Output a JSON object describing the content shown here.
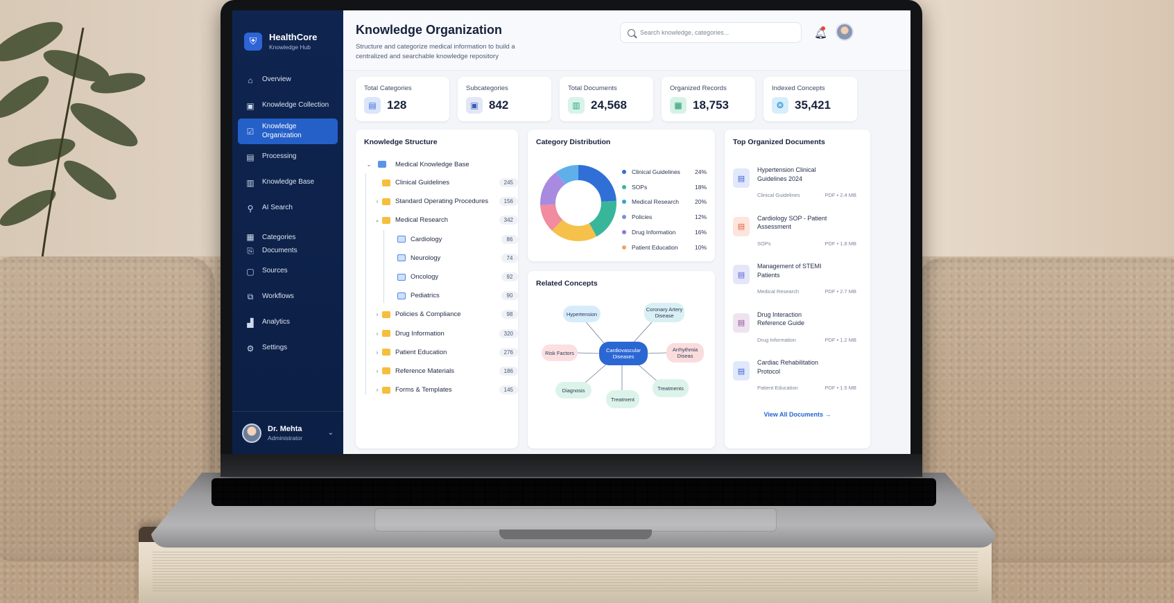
{
  "brand": {
    "title": "HealthCore",
    "subtitle": "Knowledge Hub"
  },
  "nav": [
    {
      "label": "Overview",
      "icon": "home-icon"
    },
    {
      "label": "Knowledge Collection",
      "icon": "clipboard-icon"
    },
    {
      "label": "Knowledge Organization",
      "icon": "checklist-icon",
      "active": true
    },
    {
      "label": "Processing",
      "icon": "processing-icon"
    },
    {
      "label": "Knowledge Base",
      "icon": "book-icon"
    },
    {
      "label": "AI Search",
      "icon": "search-icon"
    },
    {
      "label": "Categories",
      "icon": "categories-icon"
    },
    {
      "label": "Documents",
      "icon": "documents-icon"
    },
    {
      "label": "Sources",
      "icon": "sources-icon"
    },
    {
      "label": "Workflows",
      "icon": "workflow-icon"
    },
    {
      "label": "Analytics",
      "icon": "analytics-icon"
    },
    {
      "label": "Settings",
      "icon": "gear-icon"
    }
  ],
  "user": {
    "name": "Dr. Mehta",
    "role": "Administrator"
  },
  "header": {
    "title": "Knowledge Organization",
    "description": "Structure and categorize medical information to build a centralized and searchable knowledge repository",
    "search_placeholder": "Search knowledge, categories..."
  },
  "stats": [
    {
      "label": "Total Categories",
      "value": "128",
      "color": "#dbe6fb",
      "icon_color": "#3a6fd8"
    },
    {
      "label": "Subcategories",
      "value": "842",
      "color": "#e1e7f7",
      "icon_color": "#3b5db5"
    },
    {
      "label": "Total Documents",
      "value": "24,568",
      "color": "#d9f3ea",
      "icon_color": "#2aa57c"
    },
    {
      "label": "Organized Records",
      "value": "18,753",
      "color": "#d6f2e6",
      "icon_color": "#1f9a6c"
    },
    {
      "label": "Indexed Concepts",
      "value": "35,421",
      "color": "#d6eefb",
      "icon_color": "#2b8fd6"
    }
  ],
  "structure": {
    "title": "Knowledge Structure",
    "root": "Medical Knowledge Base",
    "items": [
      {
        "label": "Clinical Guidelines",
        "count": "245",
        "level": 1,
        "toggle": ""
      },
      {
        "label": "Standard Operating Procedures",
        "count": "156",
        "level": 1,
        "toggle": "›"
      },
      {
        "label": "Medical Research",
        "count": "342",
        "level": 1,
        "toggle": "⌄"
      },
      {
        "label": "Cardiology",
        "count": "86",
        "level": 2,
        "toggle": ""
      },
      {
        "label": "Neurology",
        "count": "74",
        "level": 2,
        "toggle": ""
      },
      {
        "label": "Oncology",
        "count": "92",
        "level": 2,
        "toggle": ""
      },
      {
        "label": "Pediatrics",
        "count": "90",
        "level": 2,
        "toggle": ""
      },
      {
        "label": "Policies & Compliance",
        "count": "98",
        "level": 1,
        "toggle": "›"
      },
      {
        "label": "Drug Information",
        "count": "320",
        "level": 1,
        "toggle": "›"
      },
      {
        "label": "Patient Education",
        "count": "276",
        "level": 1,
        "toggle": "›"
      },
      {
        "label": "Reference Materials",
        "count": "186",
        "level": 1,
        "toggle": "›"
      },
      {
        "label": "Forms & Templates",
        "count": "145",
        "level": 1,
        "toggle": "›"
      }
    ]
  },
  "distribution": {
    "title": "Category Distribution",
    "segments": [
      {
        "label": "Clinical Guidelines",
        "value": "24%",
        "pct": 24,
        "color": "#2f6fd6"
      },
      {
        "label": "SOPs",
        "value": "18%",
        "pct": 18,
        "color": "#37b69a"
      },
      {
        "label": "Medical Research",
        "value": "20%",
        "pct": 20,
        "color": "#f6c14b"
      },
      {
        "label": "Policies",
        "value": "12%",
        "pct": 12,
        "color": "#f08ba0"
      },
      {
        "label": "Drug Information",
        "value": "16%",
        "pct": 16,
        "color": "#a88be0"
      },
      {
        "label": "Patient Education",
        "value": "10%",
        "pct": 10,
        "color": "#5fb0ea"
      }
    ],
    "legend_colors": [
      "#2f6fd6",
      "#37b69a",
      "#2fa6c9",
      "#7a8fd0",
      "#8b78d8",
      "#f1a46a"
    ]
  },
  "concepts": {
    "title": "Related Concepts",
    "center": "Cardiovascular Diseases",
    "nodes": [
      "Hypertension",
      "Coronary Artery Disease",
      "Arrhythmia Diseas",
      "Risk Factors",
      "Diagnosis",
      "Treatment",
      "Treatments"
    ]
  },
  "documents": {
    "title": "Top Organized Documents",
    "items": [
      {
        "title": "Hypertension Clinical Guidelines 2024",
        "category": "Clinical Guidelines",
        "meta": "PDF • 2.4 MB",
        "bg": "#e2e8fb",
        "fg": "#3a5fcf"
      },
      {
        "title": "Cardiology SOP - Patient Assessment",
        "category": "SOPs",
        "meta": "PDF • 1.8 MB",
        "bg": "#fde4dc",
        "fg": "#e2643c"
      },
      {
        "title": "Management of STEMI Patients",
        "category": "Medical Research",
        "meta": "PDF • 2.7 MB",
        "bg": "#e4e6fa",
        "fg": "#5a5fcf"
      },
      {
        "title": "Drug Interaction Reference Guide",
        "category": "Drug Information",
        "meta": "PDF • 1.2 MB",
        "bg": "#efe3f0",
        "fg": "#8d4f9a"
      },
      {
        "title": "Cardiac Rehabilitation Protocol",
        "category": "Patient Education",
        "meta": "PDF • 1.5 MB",
        "bg": "#e0e8fb",
        "fg": "#3a62cf"
      }
    ],
    "view_all": "View All Documents →"
  }
}
